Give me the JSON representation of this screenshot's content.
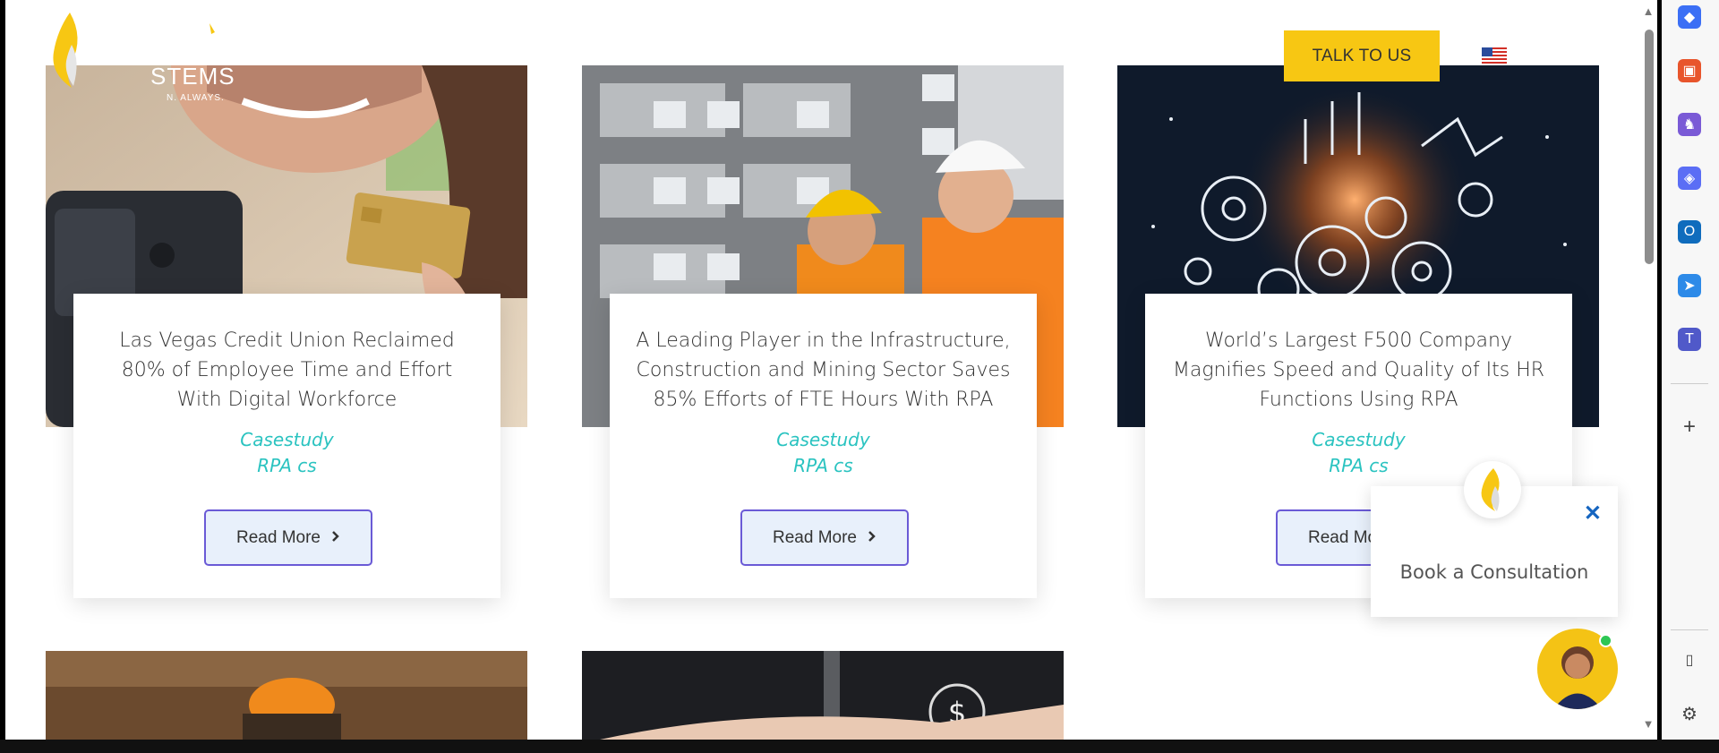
{
  "header": {
    "logo_partial_text": "STEMS",
    "logo_tagline_partial": "N. ALWAYS.",
    "talk_button": "TALK TO US",
    "language_flag": "us-flag-icon"
  },
  "cards": [
    {
      "title": "Las Vegas Credit Union Reclaimed 80% of Employee Time and Effort With Digital Workforce",
      "category": "Casestudy",
      "tag": "RPA cs",
      "button": "Read More"
    },
    {
      "title": "A Leading Player in the Infrastructure, Construction and Mining Sector Saves 85% Efforts of FTE Hours With RPA",
      "category": "Casestudy",
      "tag": "RPA cs",
      "button": "Read More"
    },
    {
      "title": "World’s Largest F500 Company Magnifies Speed and Quality of Its HR Functions Using RPA",
      "category": "Casestudy",
      "tag": "RPA cs",
      "button": "Read More"
    }
  ],
  "popup": {
    "text": "Book a Consultation",
    "close": "✕"
  },
  "sidebar_icons": [
    "tag-icon",
    "briefcase-icon",
    "chess-icon",
    "copilot-icon",
    "outlook-icon",
    "send-icon",
    "teams-icon",
    "add-icon",
    "sidebar-toggle-icon",
    "settings-icon"
  ],
  "colors": {
    "accent_yellow": "#f7c713",
    "category_teal": "#2ac3c0",
    "button_border": "#6a5ad6"
  }
}
